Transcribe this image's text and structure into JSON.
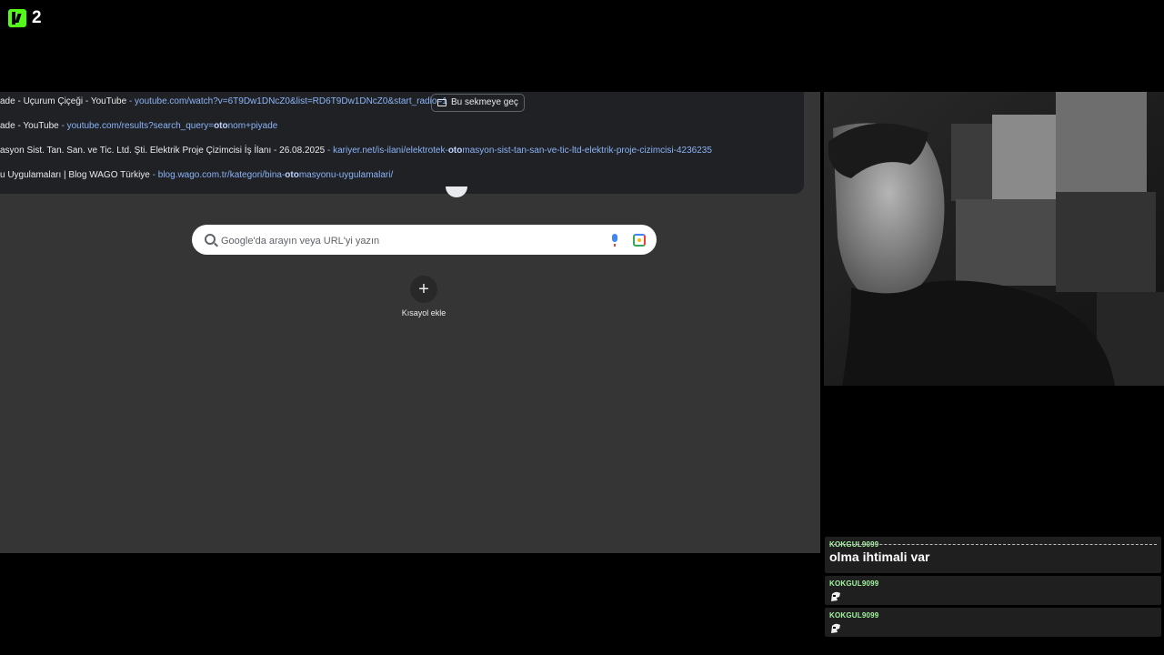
{
  "overlay": {
    "logo_number": "2"
  },
  "browser": {
    "suggestions": [
      {
        "title": "ade - Uçurum Çiçeği - YouTube",
        "sep": " - ",
        "url_pre": "youtube.com/watch?v=6T9Dw1DNcZ0&list=RD6T9Dw1DNcZ0&start_radio=1",
        "url_bold": "",
        "url_post": ""
      },
      {
        "title": "ade - YouTube",
        "sep": " - ",
        "url_pre": "youtube.com/results?search_query=",
        "url_bold": "oto",
        "url_post": "nom+piyade"
      },
      {
        "title": "asyon Sist. Tan. San. ve Tic. Ltd. Şti. Elektrik Proje Çizimcisi İş İlanı - 26.08.2025",
        "sep": " - ",
        "url_pre": "kariyer.net/is-ilani/elektrotek-",
        "url_bold": "oto",
        "url_post": "masyon-sist-tan-san-ve-tic-ltd-elektrik-proje-cizimcisi-4236235"
      },
      {
        "title": "u Uygulamaları | Blog WAGO Türkiye",
        "sep": " - ",
        "url_pre": "blog.wago.com.tr/kategori/bina-",
        "url_bold": "oto",
        "url_post": "masyonu-uygulamalari/"
      }
    ],
    "switch_tab_label": "Bu sekmeye geç",
    "search_placeholder": "Google'da arayın veya URL'yi yazın",
    "shortcut_plus": "+",
    "shortcut_label": "Kısayol ekle"
  },
  "chat": {
    "messages": [
      {
        "user": "KOKGUL9099",
        "text": "olma ihtimali var"
      },
      {
        "user": "KOKGUL9099",
        "emote": "emote-icon"
      },
      {
        "user": "KOKGUL9099",
        "emote": "emote-icon"
      }
    ]
  },
  "colors": {
    "kick_green": "#53fc18",
    "username": "#a3f5a0",
    "link": "#8ab4f8"
  }
}
